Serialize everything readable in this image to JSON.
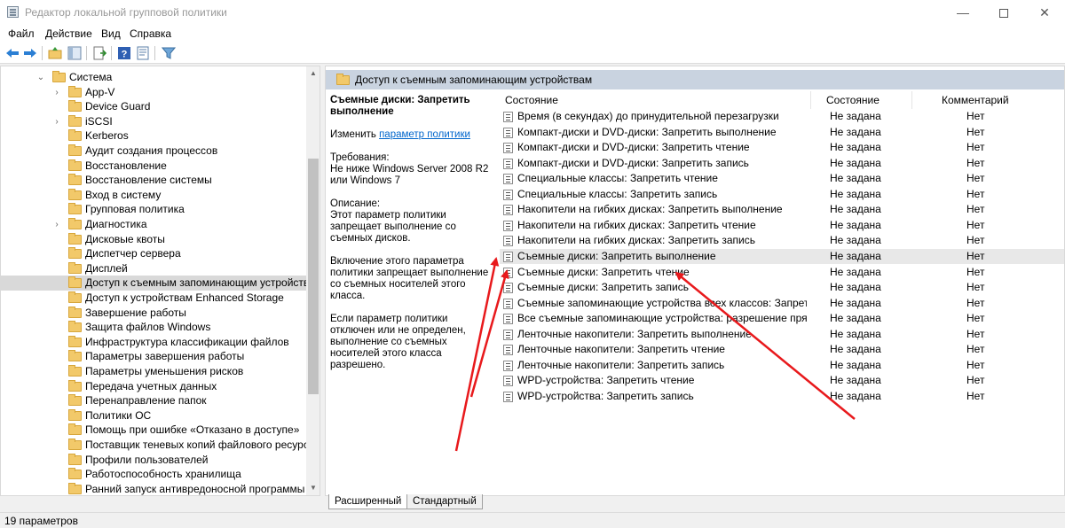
{
  "window": {
    "title": "Редактор локальной групповой политики",
    "minimize_glyph": "—",
    "close_glyph": "✕"
  },
  "menu": [
    "Файл",
    "Действие",
    "Вид",
    "Справка"
  ],
  "toolbar_icons": [
    "back-arrow-icon",
    "forward-arrow-icon",
    "up-folder-icon",
    "show-hide-tree-icon",
    "export-list-icon",
    "help-icon",
    "properties-icon",
    "filter-icon"
  ],
  "tree": {
    "items": [
      {
        "label": "Система",
        "expanded": true,
        "level": 0
      },
      {
        "label": "App-V",
        "expandable": true,
        "level": 1
      },
      {
        "label": "Device Guard",
        "level": 1
      },
      {
        "label": "iSCSI",
        "expandable": true,
        "level": 1
      },
      {
        "label": "Kerberos",
        "level": 1
      },
      {
        "label": "Аудит создания процессов",
        "level": 1
      },
      {
        "label": "Восстановление",
        "level": 1
      },
      {
        "label": "Восстановление системы",
        "level": 1
      },
      {
        "label": "Вход в систему",
        "level": 1
      },
      {
        "label": "Групповая политика",
        "level": 1
      },
      {
        "label": "Диагностика",
        "expandable": true,
        "level": 1
      },
      {
        "label": "Дисковые квоты",
        "level": 1
      },
      {
        "label": "Диспетчер сервера",
        "level": 1
      },
      {
        "label": "Дисплей",
        "level": 1
      },
      {
        "label": "Доступ к съемным запоминающим устройствам",
        "selected": true,
        "level": 1
      },
      {
        "label": "Доступ к устройствам Enhanced Storage",
        "level": 1
      },
      {
        "label": "Завершение работы",
        "level": 1
      },
      {
        "label": "Защита файлов Windows",
        "level": 1
      },
      {
        "label": "Инфраструктура классификации файлов",
        "level": 1
      },
      {
        "label": "Параметры завершения работы",
        "level": 1
      },
      {
        "label": "Параметры уменьшения рисков",
        "level": 1
      },
      {
        "label": "Передача учетных данных",
        "level": 1
      },
      {
        "label": "Перенаправление папок",
        "level": 1
      },
      {
        "label": "Политики ОС",
        "level": 1
      },
      {
        "label": "Помощь при ошибке «Отказано в доступе»",
        "level": 1
      },
      {
        "label": "Поставщик теневых копий файлового ресурса об",
        "level": 1
      },
      {
        "label": "Профили пользователей",
        "level": 1
      },
      {
        "label": "Работоспособность хранилища",
        "level": 1
      },
      {
        "label": "Ранний запуск антивредоносной программы",
        "level": 1
      }
    ],
    "expand_glyph": "›",
    "collapse_glyph": "⌄",
    "scroll_up_glyph": "▲",
    "scroll_down_glyph": "▼"
  },
  "right": {
    "header_title": "Доступ к съемным запоминающим устройствам",
    "desc": {
      "title": "Съемные диски: Запретить выполнение",
      "edit_prefix": "Изменить ",
      "edit_link": "параметр политики",
      "requirements_label": "Требования:",
      "requirements_text": "Не ниже Windows Server 2008 R2 или Windows 7",
      "description_label": "Описание:",
      "description_text": "Этот параметр политики запрещает выполнение со съемных дисков.",
      "para1": "Включение этого параметра политики запрещает выполнение со съемных носителей этого класса.",
      "para2": "Если параметр политики отключен или не определен, выполнение со съемных носителей этого класса разрешено."
    },
    "columns": {
      "name": "Состояние",
      "state": "Состояние",
      "comment": "Комментарий"
    },
    "rows": [
      {
        "name": "Время (в секундах) до принудительной перезагрузки",
        "state": "Не задана",
        "comment": "Нет"
      },
      {
        "name": "Компакт-диски и DVD-диски: Запретить выполнение",
        "state": "Не задана",
        "comment": "Нет"
      },
      {
        "name": "Компакт-диски и DVD-диски: Запретить чтение",
        "state": "Не задана",
        "comment": "Нет"
      },
      {
        "name": "Компакт-диски и DVD-диски: Запретить запись",
        "state": "Не задана",
        "comment": "Нет"
      },
      {
        "name": "Специальные классы: Запретить чтение",
        "state": "Не задана",
        "comment": "Нет"
      },
      {
        "name": "Специальные классы: Запретить запись",
        "state": "Не задана",
        "comment": "Нет"
      },
      {
        "name": "Накопители на гибких дисках: Запретить выполнение",
        "state": "Не задана",
        "comment": "Нет"
      },
      {
        "name": "Накопители на гибких дисках: Запретить чтение",
        "state": "Не задана",
        "comment": "Нет"
      },
      {
        "name": "Накопители на гибких дисках: Запретить запись",
        "state": "Не задана",
        "comment": "Нет"
      },
      {
        "name": "Съемные диски: Запретить выполнение",
        "state": "Не задана",
        "comment": "Нет",
        "selected": true
      },
      {
        "name": "Съемные диски: Запретить чтение",
        "state": "Не задана",
        "comment": "Нет"
      },
      {
        "name": "Съемные диски: Запретить запись",
        "state": "Не задана",
        "comment": "Нет"
      },
      {
        "name": "Съемные запоминающие устройства всех классов: Запретить ...",
        "state": "Не задана",
        "comment": "Нет"
      },
      {
        "name": "Все съемные запоминающие устройства: разрешение прямог...",
        "state": "Не задана",
        "comment": "Нет"
      },
      {
        "name": "Ленточные накопители: Запретить выполнение",
        "state": "Не задана",
        "comment": "Нет"
      },
      {
        "name": "Ленточные накопители: Запретить чтение",
        "state": "Не задана",
        "comment": "Нет"
      },
      {
        "name": "Ленточные накопители: Запретить запись",
        "state": "Не задана",
        "comment": "Нет"
      },
      {
        "name": "WPD-устройства: Запретить чтение",
        "state": "Не задана",
        "comment": "Нет"
      },
      {
        "name": "WPD-устройства: Запретить запись",
        "state": "Не задана",
        "comment": "Нет"
      }
    ]
  },
  "tabs": [
    "Расширенный",
    "Стандартный"
  ],
  "status": "19 параметров",
  "annotation_color": "#e8191c"
}
